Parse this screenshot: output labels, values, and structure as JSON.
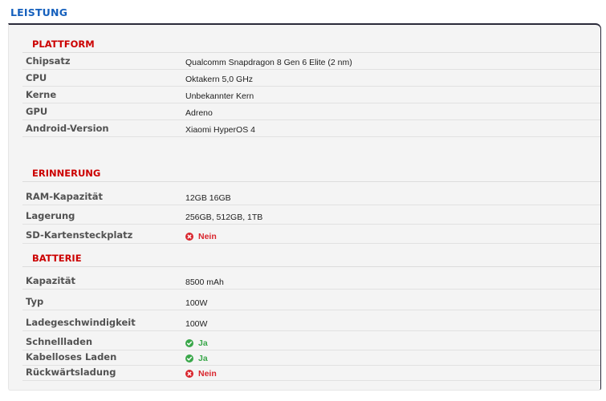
{
  "colors": {
    "heading": "#1560bd",
    "section": "#cc0000",
    "yes": "#3aa74a",
    "no": "#d9252d"
  },
  "page": {
    "title": "LEISTUNG"
  },
  "sections": [
    {
      "title": "PLATTFORM",
      "rows": [
        {
          "label": "Chipsatz",
          "value": "Qualcomm Snapdragon 8 Gen 6 Elite (2 nm)"
        },
        {
          "label": "CPU",
          "value": "Oktakern 5,0 GHz"
        },
        {
          "label": "Kerne",
          "value": "Unbekannter Kern"
        },
        {
          "label": "GPU",
          "value": "Adreno"
        },
        {
          "label": "Android-Version",
          "value": "Xiaomi HyperOS 4"
        }
      ]
    },
    {
      "title": "ERINNERUNG",
      "rows": [
        {
          "label": "RAM-Kapazität",
          "value": "12GB 16GB"
        },
        {
          "label": "Lagerung",
          "value": "256GB, 512GB, 1TB"
        },
        {
          "label": "SD-Kartensteckplatz",
          "value": "Nein",
          "status": "no",
          "icon": "cross-circle-icon"
        }
      ]
    },
    {
      "title": "BATTERIE",
      "rows": [
        {
          "label": "Kapazität",
          "value": "8500 mAh"
        },
        {
          "label": "Typ",
          "value": "100W"
        },
        {
          "label": "Ladegeschwindigkeit",
          "value": "100W"
        },
        {
          "label": "Schnellladen",
          "value": "Ja",
          "status": "yes",
          "icon": "check-circle-icon"
        },
        {
          "label": "Kabelloses Laden",
          "value": "Ja",
          "status": "yes",
          "icon": "check-circle-icon"
        },
        {
          "label": "Rückwärtsladung",
          "value": "Nein",
          "status": "no",
          "icon": "cross-circle-icon"
        }
      ]
    }
  ]
}
